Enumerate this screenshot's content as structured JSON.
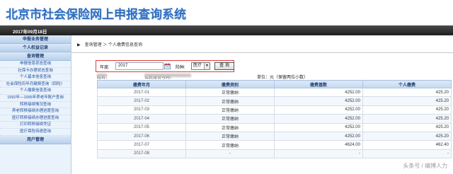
{
  "header": {
    "title": "北京市社会保险网上申报查询系统"
  },
  "datebar": {
    "date": "2017年09月18日"
  },
  "sidebar": {
    "sections": [
      {
        "label": "申报业务管理",
        "items": []
      },
      {
        "label": "个人权益记录",
        "items": []
      },
      {
        "label": "查询管理",
        "items": [
          "申报信息状态查询",
          "社保卡办理状态查询",
          "个人基本信息查询",
          "社会保险历年月缴费查询（四险）",
          "个人缴费信息查询",
          "1992年—1995年养老年账户查询",
          "转移接续情况查询",
          "养老转移接续办理进度查询",
          "医疗转移接续办理进度查询",
          "打印转移接续凭证",
          "医疗保险待遇查询"
        ]
      },
      {
        "label": "用户管理",
        "items": []
      }
    ]
  },
  "breadcrumb": {
    "text": "查询管理 ＞ 个人缴费信息查询"
  },
  "query": {
    "year_label": "年度:",
    "year_value": "2017",
    "insurance_label": "险种:",
    "insurance_value": "医疗",
    "query_button": "查 询"
  },
  "info": {
    "name_label": "姓名：",
    "id_label": "公民身份号码：",
    "unit_label": "单位：元（保留两位小数）"
  },
  "table": {
    "headers": [
      "缴费年月",
      "缴费类别",
      "缴费基数",
      "个人缴费"
    ],
    "rows": [
      [
        "2017-01",
        "正常缴纳",
        "4252.00",
        "425.20"
      ],
      [
        "2017-02",
        "正常缴纳",
        "4252.00",
        "425.20"
      ],
      [
        "2017-03",
        "正常缴纳",
        "4252.00",
        "425.20"
      ],
      [
        "2017-04",
        "正常缴纳",
        "4252.00",
        "425.20"
      ],
      [
        "2017-05",
        "正常缴纳",
        "4252.00",
        "425.20"
      ],
      [
        "2017-06",
        "正常缴纳",
        "4252.00",
        "425.20"
      ],
      [
        "2017-07",
        "正常缴纳",
        "4624.00",
        "462.40"
      ],
      [
        "2017-08",
        "-",
        "-",
        "-"
      ]
    ]
  },
  "watermark": {
    "text": "头条号 / 编博人力"
  }
}
